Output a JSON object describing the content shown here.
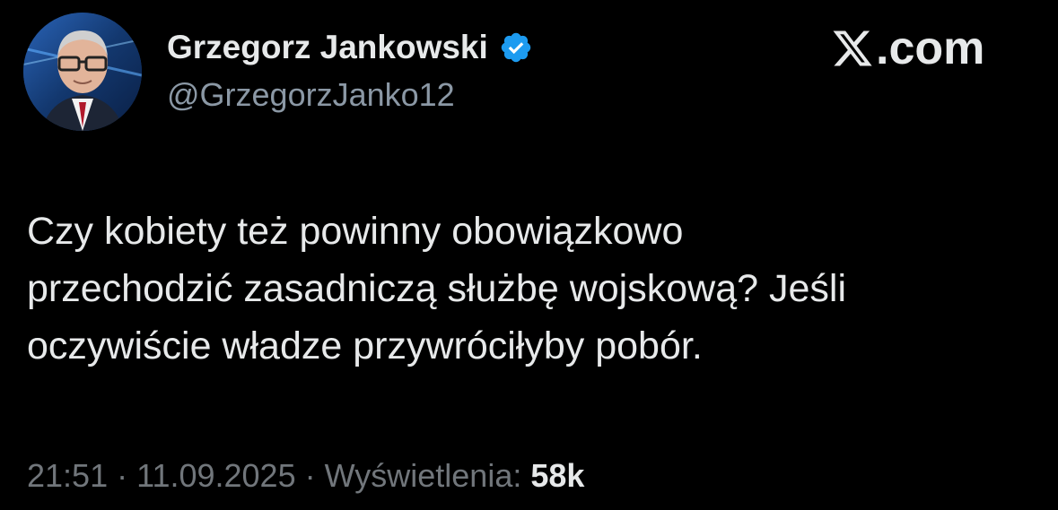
{
  "author": {
    "display_name": "Grzegorz Jankowski",
    "handle": "@GrzegorzJanko12",
    "verified_icon": "verified-badge-icon",
    "verified_color": "#1d9bf0"
  },
  "brand": {
    "logo_icon": "x-logo-icon",
    "suffix": ".com"
  },
  "tweet": {
    "lines": [
      "Czy kobiety też powinny obowiązkowo",
      "przechodzić zasadniczą służbę wojskową? Jeśli",
      "oczywiście władze przywróciłyby pobór."
    ]
  },
  "meta": {
    "time": "21:51",
    "separator": "·",
    "date": "11.09.2025",
    "views_label": "Wyświetlenia:",
    "views_count": "58k"
  },
  "colors": {
    "background": "#000000",
    "primary_text": "#e7e9ea",
    "secondary_text": "#71767b",
    "accent": "#1d9bf0"
  }
}
